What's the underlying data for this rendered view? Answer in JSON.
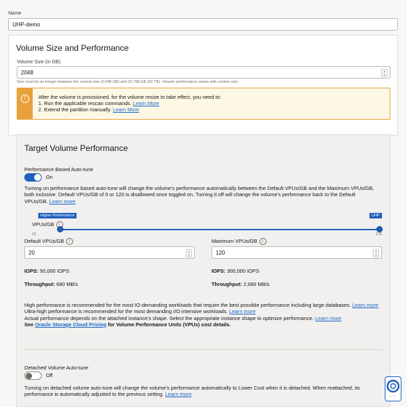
{
  "name": {
    "label": "Name",
    "value": "UHP-demo"
  },
  "size_section": {
    "title": "Volume Size and Performance",
    "size_label": "Volume Size (in GB)",
    "size_value": "2048",
    "help": "Size must be an integer between the current size (2,048 GB) and 32,768 GB (32 TB). Volume performance varies with volume size.",
    "warning": {
      "intro": "After the volume is provisioned, for the volume resize to take effect, you need to:",
      "step1": "1. Run the applicable rescan commands.",
      "step2": "2. Extend the partition manually.",
      "learn_more": "Learn More"
    }
  },
  "target": {
    "title": "Target Volume Performance",
    "autotune_label": "Performance Based Auto-tune",
    "autotune_state": "On",
    "autotune_desc": "Turning on performance based auto-tune will change the volume's performance automatically between the Default VPUs/GB and the Maximum VPUs/GB, both inclusive. Default VPUs/GB of 0 or 120 is disallowed once toggled on. Turning it off will change the volume's performance back to the Default VPUs/GB.",
    "learn_more": "Learn more",
    "slider": {
      "tag_left": "Higher Performance",
      "tag_right": "UHP",
      "axis_label": "VPUs/GB",
      "min": "10",
      "max": "120",
      "default_value": 10,
      "max_value": 120
    },
    "default_label": "Default VPUs/GB",
    "default_value": "20",
    "max_label": "Maximum VPUs/GB",
    "max_value": "120",
    "left_stats": {
      "iops_label": "IOPS:",
      "iops": "50,000 IOPS",
      "tp_label": "Throughput:",
      "tp": "680 MB/s"
    },
    "right_stats": {
      "iops_label": "IOPS:",
      "iops": "300,000 IOPS",
      "tp_label": "Throughput:",
      "tp": "2,680 MB/s"
    },
    "note1": "High performance is recommended for the most IO-demanding workloads that require the best possible performance including large databases.",
    "note1_link": "Learn more",
    "note2": "Ultra-high performance is recommended for the most demanding I/O intensive workloads.",
    "note2_link": "Learn more",
    "note3": "Actual performance depends on the attached instance's shape. Select the appropriate instance shape to optimize performance.",
    "note3_link": "Learn more",
    "see": "See",
    "pricing_link": "Oracle Storage Cloud Pricing",
    "pricing_rest": "for Volume Performance Units (VPUs) cost details."
  },
  "detached": {
    "label": "Detached Volume Auto-tune",
    "state": "Off",
    "desc": "Turning on detached volume auto-tune will change the volume's performance automatically to Lower Cost when it is detached. When reattached, its performance is automatically adjusted to the previous setting.",
    "learn_more": "Learn more"
  },
  "help_widget": {
    "icon": "lifebuoy-icon"
  },
  "colors": {
    "accent": "#1f5fbf",
    "warning": "#e8a23b",
    "link": "#1a66c9"
  }
}
